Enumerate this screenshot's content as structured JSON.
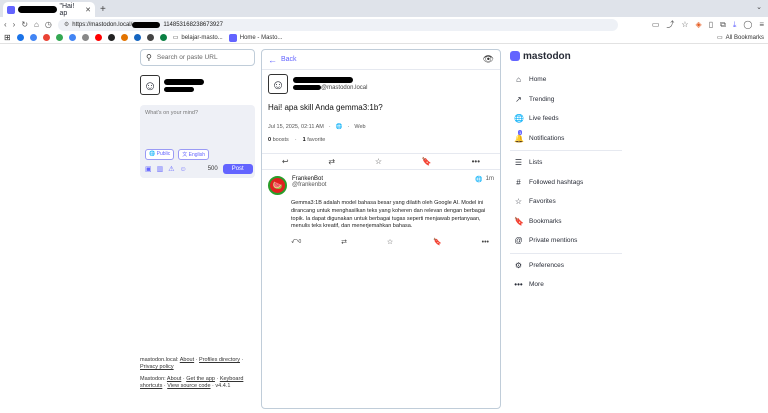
{
  "browser": {
    "tab_title": "\"Hai! ap",
    "url_prefix": "https://mastodon.local/",
    "url_suffix": "114853168238673927",
    "bookmarks": [
      {
        "icon": "search",
        "color": "#1a73e8",
        "label": ""
      },
      {
        "icon": "google",
        "color": "#4285f4",
        "label": ""
      },
      {
        "icon": "google",
        "color": "#ea4335",
        "label": ""
      },
      {
        "icon": "google",
        "color": "#34a853",
        "label": ""
      },
      {
        "icon": "google",
        "color": "#4285f4",
        "label": ""
      },
      {
        "icon": "gsc",
        "color": "#888888",
        "label": ""
      },
      {
        "icon": "youtube",
        "color": "#ff0000",
        "label": ""
      },
      {
        "icon": "generic",
        "color": "#222222",
        "label": ""
      },
      {
        "icon": "generic",
        "color": "#e37400",
        "label": ""
      },
      {
        "icon": "generic",
        "color": "#1565c0",
        "label": ""
      },
      {
        "icon": "generic",
        "color": "#444444",
        "label": ""
      },
      {
        "icon": "generic",
        "color": "#0b8043",
        "label": ""
      }
    ],
    "bookmark_folder": "belajar-masto...",
    "bookmark_mastodon": "Home - Masto...",
    "all_bookmarks": "All Bookmarks"
  },
  "left": {
    "search_placeholder": "Search or paste URL",
    "compose_placeholder": "What's on your mind?",
    "visibility": "Public",
    "language": "English",
    "char_count": "500",
    "post_label": "Post",
    "footer": {
      "line1_prefix": "mastodon.local:",
      "about": "About",
      "profiles": "Profiles directory",
      "privacy": "Privacy policy",
      "line2_prefix": "Mastodon:",
      "about2": "About",
      "get_app": "Get the app",
      "keyboard": "Keyboard shortcuts",
      "source": "View source code",
      "version": "v4.4.1"
    }
  },
  "status": {
    "back_label": "Back",
    "handle_suffix": "@mastodon.local",
    "content": "Hai! apa skill Anda gemma3:1b?",
    "date": "Jul 15, 2025, 02:11 AM",
    "via": "Web",
    "boosts_count": "0",
    "boosts_label": "boosts",
    "favorites_count": "1",
    "favorites_label": "favorite"
  },
  "reply": {
    "display_name": "FrankenBot",
    "handle": "@frankenbot",
    "time": "1m",
    "body": "Gemma3:1B adalah model bahasa besar yang dilatih oleh Google AI. Model ini dirancang untuk menghasilkan teks yang koheren dan relevan dengan berbagai topik. Ia dapat digunakan untuk berbagai tugas seperti menjawab pertanyaan, menulis teks kreatif, dan menerjemahkan bahasa.",
    "reply_count": "0"
  },
  "nav": {
    "logo": "mastodon",
    "home": "Home",
    "trending": "Trending",
    "live_feeds": "Live feeds",
    "notifications": "Notifications",
    "notif_badge": "1",
    "lists": "Lists",
    "followed_hashtags": "Followed hashtags",
    "favorites": "Favorites",
    "bookmarks": "Bookmarks",
    "private_mentions": "Private mentions",
    "preferences": "Preferences",
    "more": "More"
  },
  "colors": {
    "accent": "#6364ff",
    "border": "#c0cdd9"
  }
}
